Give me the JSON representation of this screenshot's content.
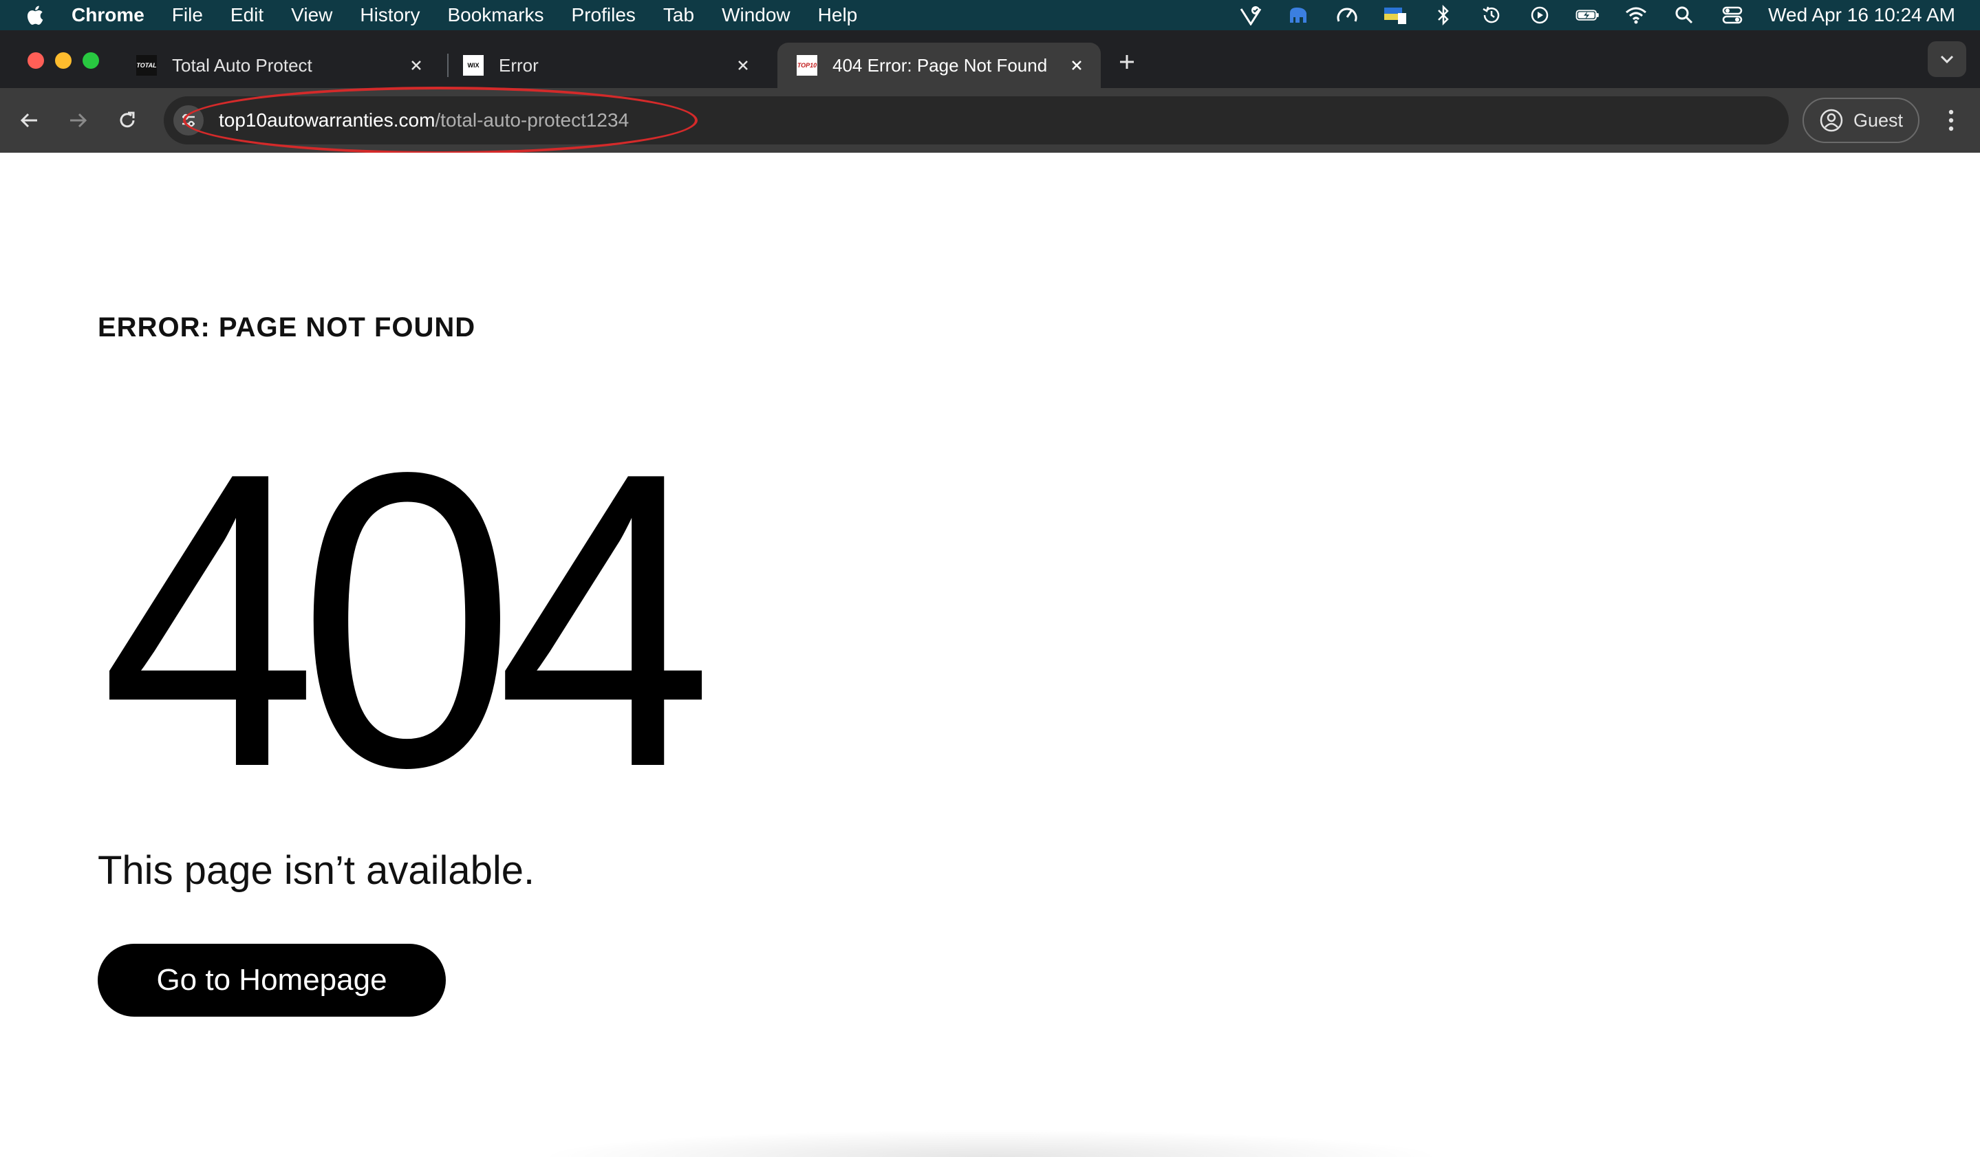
{
  "menubar": {
    "app_name": "Chrome",
    "items": [
      "File",
      "Edit",
      "View",
      "History",
      "Bookmarks",
      "Profiles",
      "Tab",
      "Window",
      "Help"
    ],
    "clock": "Wed Apr 16  10:24 AM",
    "status_icons": [
      "vpn-icon",
      "elephant-icon",
      "gauge-icon",
      "display-icon",
      "bluetooth-icon",
      "time-machine-icon",
      "play-icon",
      "battery-icon",
      "wifi-icon",
      "spotlight-icon",
      "control-center-icon"
    ]
  },
  "tabs": [
    {
      "title": "Total Auto Protect",
      "favicon_text": "TOTAL",
      "active": false
    },
    {
      "title": "Error",
      "favicon_text": "WIX",
      "active": false
    },
    {
      "title": "404 Error: Page Not Found",
      "favicon_text": "TOP10",
      "active": true
    }
  ],
  "toolbar": {
    "url_host": "top10autowarranties.com",
    "url_path": "/total-auto-protect1234",
    "profile_label": "Guest"
  },
  "page": {
    "heading": "ERROR: PAGE NOT FOUND",
    "code": "404",
    "message": "This page isn’t available.",
    "button_label": "Go to Homepage"
  },
  "colors": {
    "menubar_bg": "#0f3a45",
    "tabstrip_bg": "#202124",
    "toolbar_bg": "#3c3c3c",
    "annotation": "#d42a2a",
    "button_bg": "#000000"
  }
}
